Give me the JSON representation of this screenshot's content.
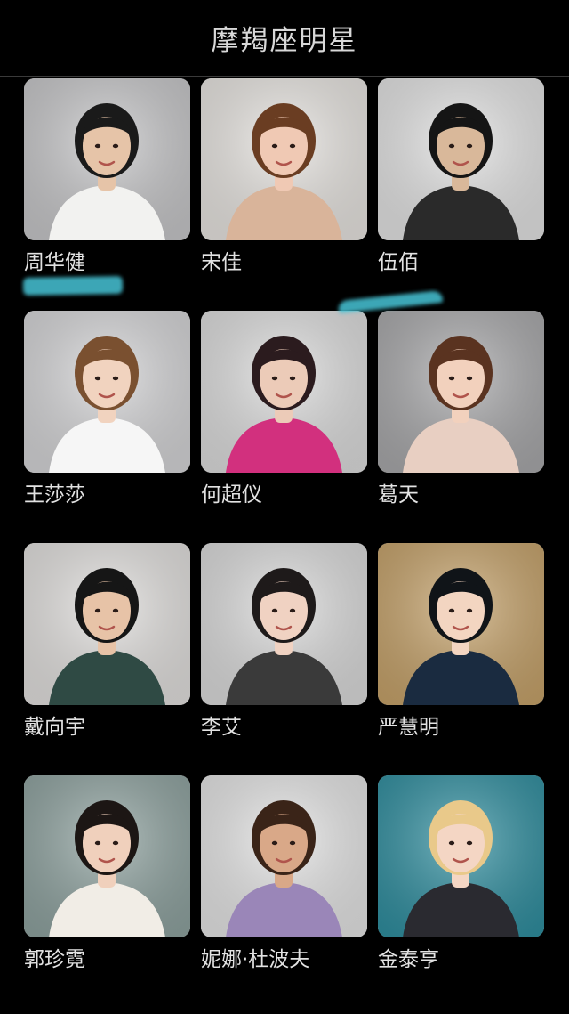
{
  "header": {
    "title": "摩羯座明星"
  },
  "stars": [
    {
      "name": "周华健",
      "photo": "person-photo",
      "bg": "#c8c8ca",
      "skin": "#e6c4a8",
      "hair": "#1a1a1a",
      "cloth": "#f2f2f0"
    },
    {
      "name": "宋佳",
      "photo": "person-photo",
      "bg": "#e9e6e2",
      "skin": "#f0c9b4",
      "hair": "#6a3d22",
      "cloth": "#d9b49a"
    },
    {
      "name": "伍佰",
      "photo": "person-photo",
      "bg": "#e4e4e4",
      "skin": "#d9b89a",
      "hair": "#151515",
      "cloth": "#2a2a2a"
    },
    {
      "name": "王莎莎",
      "photo": "person-photo",
      "bg": "#d6d6d8",
      "skin": "#f1d3bf",
      "hair": "#7a5030",
      "cloth": "#f6f6f6"
    },
    {
      "name": "何超仪",
      "photo": "person-photo",
      "bg": "#dedede",
      "skin": "#eccbb8",
      "hair": "#2b1b1e",
      "cloth": "#d2307e"
    },
    {
      "name": "葛天",
      "photo": "person-photo",
      "bg": "#a9a9ab",
      "skin": "#f2d1bd",
      "hair": "#5a3320",
      "cloth": "#e8cfc2"
    },
    {
      "name": "戴向宇",
      "photo": "person-photo",
      "bg": "#e3e1df",
      "skin": "#e7c3a7",
      "hair": "#161616",
      "cloth": "#2f4a44"
    },
    {
      "name": "李艾",
      "photo": "person-photo",
      "bg": "#dcdcdc",
      "skin": "#f0d2c2",
      "hair": "#1e1a1a",
      "cloth": "#3a3a3a"
    },
    {
      "name": "严慧明",
      "photo": "person-photo",
      "bg": "#c7a36a",
      "skin": "#f3d5c1",
      "hair": "#101418",
      "cloth": "#1a2b40"
    },
    {
      "name": "郭珍霓",
      "photo": "person-photo",
      "bg": "#8fa3a0",
      "skin": "#f0d0bc",
      "hair": "#1c1614",
      "cloth": "#f1ede6"
    },
    {
      "name": "妮娜·杜波夫",
      "photo": "person-photo",
      "bg": "#e6e6e6",
      "skin": "#d9a888",
      "hair": "#3a2418",
      "cloth": "#9a86b8"
    },
    {
      "name": "金泰亨",
      "photo": "person-photo",
      "bg": "#2f8fa0",
      "skin": "#f4d6c4",
      "hair": "#e9c98a",
      "cloth": "#2a2a30"
    }
  ],
  "colors": {
    "background": "#000000",
    "title": "#d8d8d8",
    "name": "#e2e2e2",
    "streak": "#47c4d6"
  }
}
